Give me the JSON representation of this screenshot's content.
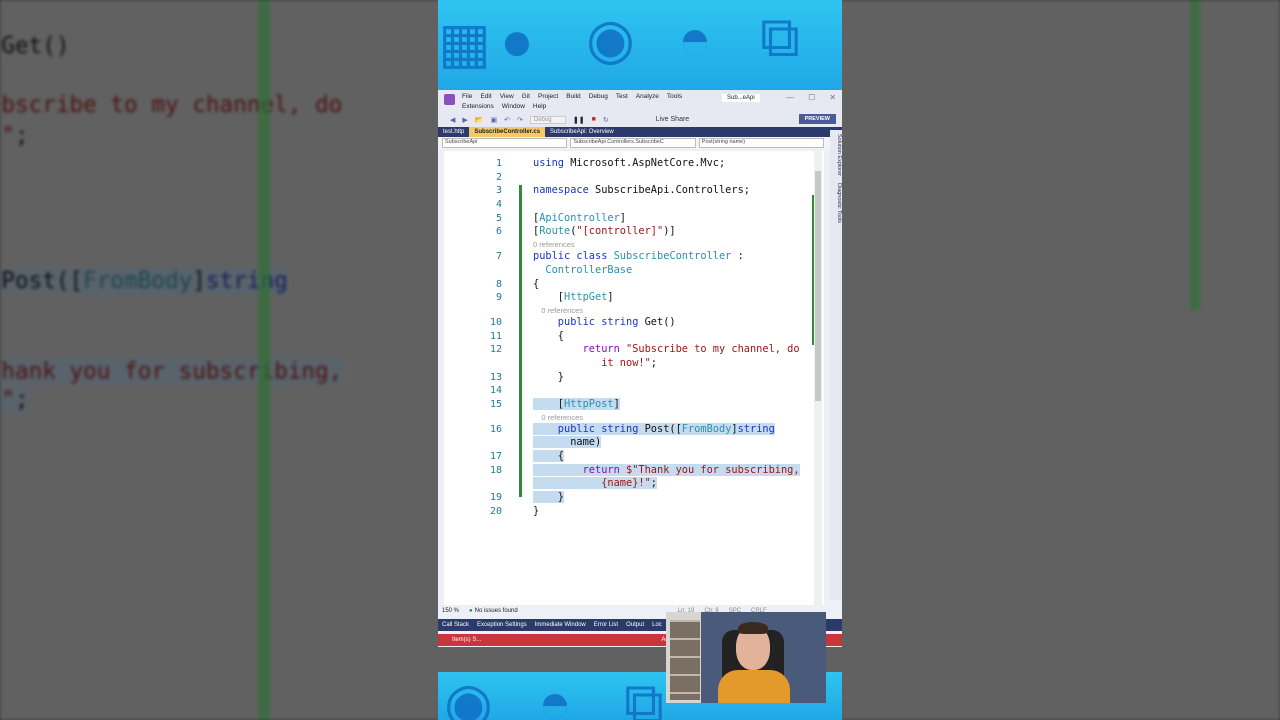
{
  "window": {
    "solution_name": "Sub...eApi",
    "preview_label": "PREVIEW",
    "live_share": "Live Share",
    "config": "Debug"
  },
  "menu": [
    "File",
    "Edit",
    "View",
    "Git",
    "Project",
    "Build",
    "Debug",
    "Test",
    "Analyze",
    "Tools",
    "Extensions",
    "Window",
    "Help"
  ],
  "tabs": [
    {
      "label": "test.http"
    },
    {
      "label": "SubscribeController.cs",
      "active": true
    },
    {
      "label": "SubscribeApi: Overview"
    }
  ],
  "nav": {
    "project": "SubscribeApi",
    "class": "SubscribeApi.Controllers.SubscribeC",
    "member": "Post(string name)"
  },
  "side_panel": {
    "solution_explorer": "Solution Explorer",
    "diagnostic_tools": "Diagnostic Tools"
  },
  "code": [
    {
      "n": "1",
      "t": [
        [
          "using ",
          "kw"
        ],
        [
          "Microsoft.AspNetCore.Mvc;",
          "pl"
        ]
      ]
    },
    {
      "n": "2",
      "t": []
    },
    {
      "n": "3",
      "t": [
        [
          "namespace ",
          "kw"
        ],
        [
          "SubscribeApi.Controllers;",
          "pl"
        ]
      ]
    },
    {
      "n": "4",
      "t": []
    },
    {
      "n": "5",
      "t": [
        [
          "[",
          "pl"
        ],
        [
          "ApiController",
          "ty"
        ],
        [
          "]",
          "pl"
        ]
      ]
    },
    {
      "n": "6",
      "t": [
        [
          "[",
          "pl"
        ],
        [
          "Route",
          "ty"
        ],
        [
          "(",
          "pl"
        ],
        [
          "\"[controller]\"",
          "st"
        ],
        [
          ")]",
          "pl"
        ]
      ]
    },
    {
      "ref": "0 references"
    },
    {
      "n": "7",
      "t": [
        [
          "public class ",
          "kw"
        ],
        [
          "SubscribeController",
          "ty"
        ],
        [
          " :",
          "pl"
        ]
      ]
    },
    {
      "n": "",
      "t": [
        [
          "  ",
          "pl"
        ],
        [
          "ControllerBase",
          "ty"
        ]
      ]
    },
    {
      "n": "8",
      "t": [
        [
          "{",
          "pl"
        ]
      ]
    },
    {
      "n": "9",
      "t": [
        [
          "    [",
          "pl"
        ],
        [
          "HttpGet",
          "ty"
        ],
        [
          "]",
          "pl"
        ]
      ]
    },
    {
      "ref": "    0 references"
    },
    {
      "n": "10",
      "t": [
        [
          "    public string ",
          "kw"
        ],
        [
          "Get()",
          "pl"
        ]
      ]
    },
    {
      "n": "11",
      "t": [
        [
          "    {",
          "pl"
        ]
      ]
    },
    {
      "n": "12",
      "t": [
        [
          "        return ",
          "ctl"
        ],
        [
          "\"Subscribe to my channel, do",
          "st"
        ]
      ]
    },
    {
      "n": "",
      "t": [
        [
          "           it now!\"",
          "st"
        ],
        [
          ";",
          "pl"
        ]
      ]
    },
    {
      "n": "13",
      "t": [
        [
          "    }",
          "pl"
        ]
      ]
    },
    {
      "n": "14",
      "t": []
    },
    {
      "n": "15",
      "sel": true,
      "t": [
        [
          "    [",
          "pl"
        ],
        [
          "HttpPost",
          "ty"
        ],
        [
          "]",
          "pl"
        ]
      ]
    },
    {
      "ref": "    0 references"
    },
    {
      "n": "16",
      "sel": true,
      "t": [
        [
          "    public string ",
          "kw"
        ],
        [
          "Post([",
          "pl"
        ],
        [
          "FromBody",
          "ty"
        ],
        [
          "]",
          "pl"
        ],
        [
          "string",
          "kw"
        ]
      ]
    },
    {
      "n": "",
      "sel": true,
      "t": [
        [
          "      name)",
          "pl"
        ]
      ]
    },
    {
      "n": "17",
      "sel": true,
      "t": [
        [
          "    {",
          "pl"
        ]
      ]
    },
    {
      "n": "18",
      "sel": true,
      "t": [
        [
          "        return ",
          "ctl"
        ],
        [
          "$\"Thank you for subscribing,",
          "st"
        ]
      ]
    },
    {
      "n": "",
      "sel": true,
      "t": [
        [
          "           {name}!\"",
          "st"
        ],
        [
          ";",
          "pl"
        ]
      ]
    },
    {
      "n": "19",
      "sel": true,
      "t": [
        [
          "    }",
          "pl"
        ]
      ]
    },
    {
      "n": "20",
      "t": [
        [
          "}",
          "pl"
        ]
      ]
    }
  ],
  "status": {
    "zoom": "150 %",
    "issues": "No issues found",
    "ln": "Ln: 19",
    "ch": "Ch: 6",
    "spc": "SPC",
    "crlf": "CRLF"
  },
  "bottom_panels": [
    "Call Stack",
    "Exception Settings",
    "Immediate Window",
    "Error List",
    "Output",
    "Loc"
  ],
  "statusbar": {
    "items": "Item(s) S...",
    "add": "Add t"
  },
  "colors": {
    "accent": "#2c3a6b",
    "banner": "#2ec4f0",
    "status_red": "#c8353a",
    "selection": "#c5dcf0"
  }
}
